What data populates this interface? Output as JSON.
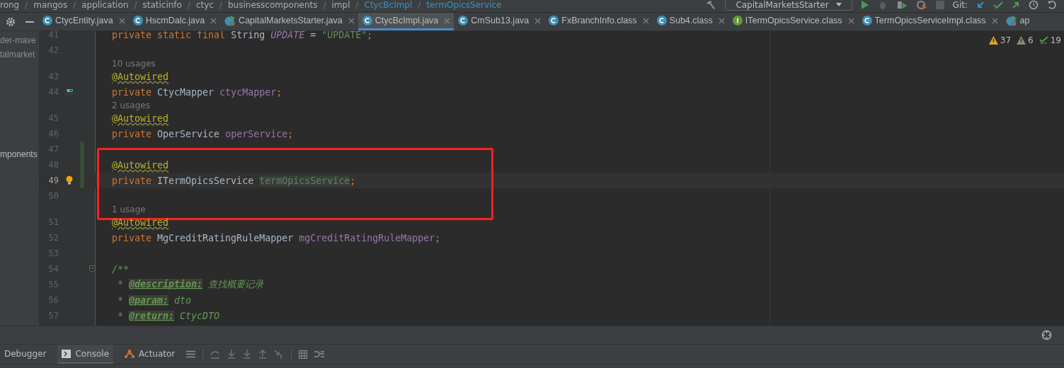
{
  "breadcrumb": [
    "rong",
    "mangos",
    "application",
    "staticinfo",
    "ctyc",
    "businesscomponents",
    "impl",
    "CtycBcImpl",
    "termOpicsService"
  ],
  "breadcrumb_separator": "/",
  "run_config": "CapitalMarketsStarter",
  "git_label": "Git:",
  "tabs": [
    {
      "label": "CtycEntity.java",
      "kind": "class",
      "selected": false,
      "closable": true
    },
    {
      "label": "HscmDalc.java",
      "kind": "class",
      "selected": false,
      "closable": true
    },
    {
      "label": "CapitalMarketsStarter.java",
      "kind": "run",
      "selected": false,
      "closable": true
    },
    {
      "label": "CtycBcImpl.java",
      "kind": "class",
      "selected": true,
      "closable": true
    },
    {
      "label": "CmSub13.java",
      "kind": "class",
      "selected": false,
      "closable": true
    },
    {
      "label": "FxBranchInfo.class",
      "kind": "class",
      "selected": false,
      "closable": true
    },
    {
      "label": "Sub4.class",
      "kind": "class",
      "selected": false,
      "closable": true
    },
    {
      "label": "ITermOpicsService.class",
      "kind": "interface",
      "selected": false,
      "closable": true
    },
    {
      "label": "TermOpicsServiceImpl.class",
      "kind": "class",
      "selected": false,
      "closable": true
    },
    {
      "label": "ap",
      "kind": "run",
      "selected": false
    }
  ],
  "project_panel": [
    "der-mave",
    "talmarket",
    "mponents"
  ],
  "inspections": [
    {
      "kind": "warning",
      "count": "37"
    },
    {
      "kind": "weak-warning",
      "count": "6"
    },
    {
      "kind": "typo",
      "count": "19"
    }
  ],
  "lines": [
    {
      "kind": "code",
      "number": "41",
      "tokens": [
        {
          "text": "private static final ",
          "kind": "keyword"
        },
        {
          "text": "String ",
          "kind": "plain"
        },
        {
          "text": "UPDATE",
          "kind": "constant"
        },
        {
          "text": " = ",
          "kind": "plain"
        },
        {
          "text": "\"UPDATE\"",
          "kind": "string"
        },
        {
          "text": ";",
          "kind": "keyword"
        }
      ]
    },
    {
      "kind": "code",
      "number": "42"
    },
    {
      "kind": "hint",
      "text": "10 usages"
    },
    {
      "kind": "code",
      "number": "43",
      "tokens": [
        {
          "text": "@Autowired",
          "kind": "annotation"
        }
      ]
    },
    {
      "kind": "code",
      "number": "44",
      "gutter": {
        "kind": "bean"
      },
      "tokens": [
        {
          "text": "private ",
          "kind": "keyword"
        },
        {
          "text": "CtycMapper ",
          "kind": "plain"
        },
        {
          "text": "ctycMapper",
          "kind": "field"
        },
        {
          "text": ";",
          "kind": "keyword"
        }
      ]
    },
    {
      "kind": "hint",
      "text": "2 usages"
    },
    {
      "kind": "code",
      "number": "45",
      "tokens": [
        {
          "text": "@Autowired",
          "kind": "annotation"
        }
      ]
    },
    {
      "kind": "code",
      "number": "46",
      "tokens": [
        {
          "text": "private ",
          "kind": "keyword"
        },
        {
          "text": "OperService ",
          "kind": "plain"
        },
        {
          "text": "operService",
          "kind": "field"
        },
        {
          "text": ";",
          "kind": "keyword"
        }
      ]
    },
    {
      "kind": "code",
      "number": "47",
      "changed": true
    },
    {
      "kind": "code",
      "number": "48",
      "changed": true,
      "boxed": true,
      "tokens": [
        {
          "text": "@Autowired",
          "kind": "annotation"
        }
      ]
    },
    {
      "kind": "code",
      "number": "49",
      "changed": true,
      "boxed": true,
      "current": true,
      "gutter": {
        "kind": "bulb"
      },
      "tokens": [
        {
          "text": "private ",
          "kind": "keyword"
        },
        {
          "text": "ITermOpicsService ",
          "kind": "plain"
        },
        {
          "text": "termOpicsService",
          "kind": "unused"
        },
        {
          "text": ";",
          "kind": "keyword"
        }
      ]
    },
    {
      "kind": "code",
      "number": "50",
      "boxed": true
    },
    {
      "kind": "hint",
      "text": "1 usage",
      "boxed": true
    },
    {
      "kind": "code",
      "number": "51",
      "tokens": [
        {
          "text": "@Autowired",
          "kind": "annotation"
        }
      ]
    },
    {
      "kind": "code",
      "number": "52",
      "tokens": [
        {
          "text": "private ",
          "kind": "keyword"
        },
        {
          "text": "MgCreditRatingRuleMapper ",
          "kind": "plain"
        },
        {
          "text": "mgCreditRatingRuleMapper",
          "kind": "field"
        },
        {
          "text": ";",
          "kind": "keyword"
        }
      ]
    },
    {
      "kind": "code",
      "number": "53"
    },
    {
      "kind": "code",
      "number": "54",
      "foldable": true,
      "tokens": [
        {
          "text": "/**",
          "kind": "doc"
        }
      ]
    },
    {
      "kind": "code",
      "number": "55",
      "tokens": [
        {
          "text": " * ",
          "kind": "doc"
        },
        {
          "text": "@description:",
          "kind": "doctag"
        },
        {
          "text": " 查找概要记录",
          "kind": "doc"
        }
      ]
    },
    {
      "kind": "code",
      "number": "56",
      "tokens": [
        {
          "text": " * ",
          "kind": "doc"
        },
        {
          "text": "@param:",
          "kind": "doctag"
        },
        {
          "text": " dto",
          "kind": "doc"
        }
      ]
    },
    {
      "kind": "code",
      "number": "57",
      "tokens": [
        {
          "text": " * ",
          "kind": "doc"
        },
        {
          "text": "@return:",
          "kind": "doctag"
        },
        {
          "text": " CtycDTO",
          "kind": "doc"
        }
      ]
    }
  ],
  "tool_tabs": [
    {
      "label": "Debugger",
      "kind": "debugger",
      "selected": false
    },
    {
      "label": "Console",
      "kind": "console",
      "selected": true
    },
    {
      "label": "Actuator",
      "kind": "actuator",
      "selected": false
    }
  ]
}
